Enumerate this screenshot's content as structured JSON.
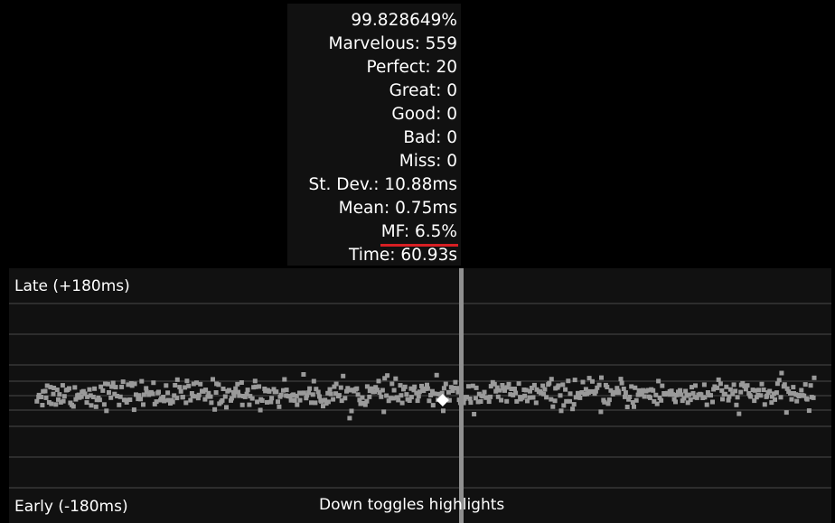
{
  "stats": {
    "accuracy": "99.828649%",
    "marvelous": "Marvelous: 559",
    "perfect": "Perfect: 20",
    "great": "Great: 0",
    "good": "Good: 0",
    "bad": "Bad: 0",
    "miss": "Miss: 0",
    "std_dev": "St. Dev.: 10.88ms",
    "mean": "Mean: 0.75ms",
    "mf": "MF: 6.5%",
    "time": "Time: 60.93s"
  },
  "graph": {
    "late_label": "Late (+180ms)",
    "early_label": "Early (-180ms)",
    "hint": "Down toggles highlights"
  },
  "colors": {
    "background": "#000000",
    "panel": "#111111",
    "grid": "#2d2d2d",
    "dot": "#9a9a9a",
    "playhead": "#8f8f8f",
    "marker": "#ffffff",
    "mf_underline": "#d71f23"
  },
  "chart_data": {
    "type": "scatter",
    "title": "",
    "xlabel": "",
    "ylabel": "",
    "xlim": [
      0,
      60.93
    ],
    "ylim": [
      -180,
      180
    ],
    "y_top_label": "Late (+180ms)",
    "y_bottom_label": "Early (-180ms)",
    "playhead_time": 31.8,
    "note_count": 579,
    "mean_offset_ms": 0.75,
    "std_dev_ms": 10.88
  }
}
